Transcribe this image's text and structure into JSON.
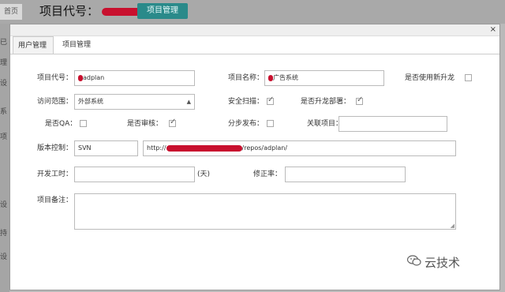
{
  "background": {
    "home_tab": "首页",
    "title": "项目代号：",
    "button": "项目管理",
    "side_fragments": [
      "已",
      "理",
      "设",
      "系",
      "项",
      "设",
      "持",
      "设"
    ]
  },
  "modal": {
    "close": "×",
    "tabs": [
      "用户管理",
      "项目管理"
    ]
  },
  "form": {
    "project_code": {
      "label": "项目代号：",
      "value": "adplan"
    },
    "project_name": {
      "label": "项目名称：",
      "value": "广告系统"
    },
    "use_new_ascend": {
      "label": "是否使用新升龙",
      "checked": false
    },
    "access_scope": {
      "label": "访问范围：",
      "value": "外部系统"
    },
    "security_scan": {
      "label": "安全扫描：",
      "checked": true
    },
    "ascend_deploy": {
      "label": "是否升龙部署：",
      "checked": true
    },
    "is_qa": {
      "label": "是否QA：",
      "checked": false
    },
    "is_review": {
      "label": "是否审核：",
      "checked": true
    },
    "step_release": {
      "label": "分步发布：",
      "checked": false
    },
    "related_project": {
      "label": "关联项目：",
      "value": ""
    },
    "version_control": {
      "label": "版本控制：",
      "type": "SVN",
      "url_prefix": "http://",
      "url_suffix": "/repos/adplan/"
    },
    "dev_days": {
      "label": "开发工时：",
      "value": "",
      "unit": "(天)"
    },
    "fix_rate": {
      "label": "修正率：",
      "value": ""
    },
    "remarks": {
      "label": "项目备注：",
      "value": ""
    }
  },
  "watermark": {
    "text": "云技术"
  },
  "colors": {
    "accent_button": "#2a8a8a",
    "redaction": "#c8102e"
  }
}
